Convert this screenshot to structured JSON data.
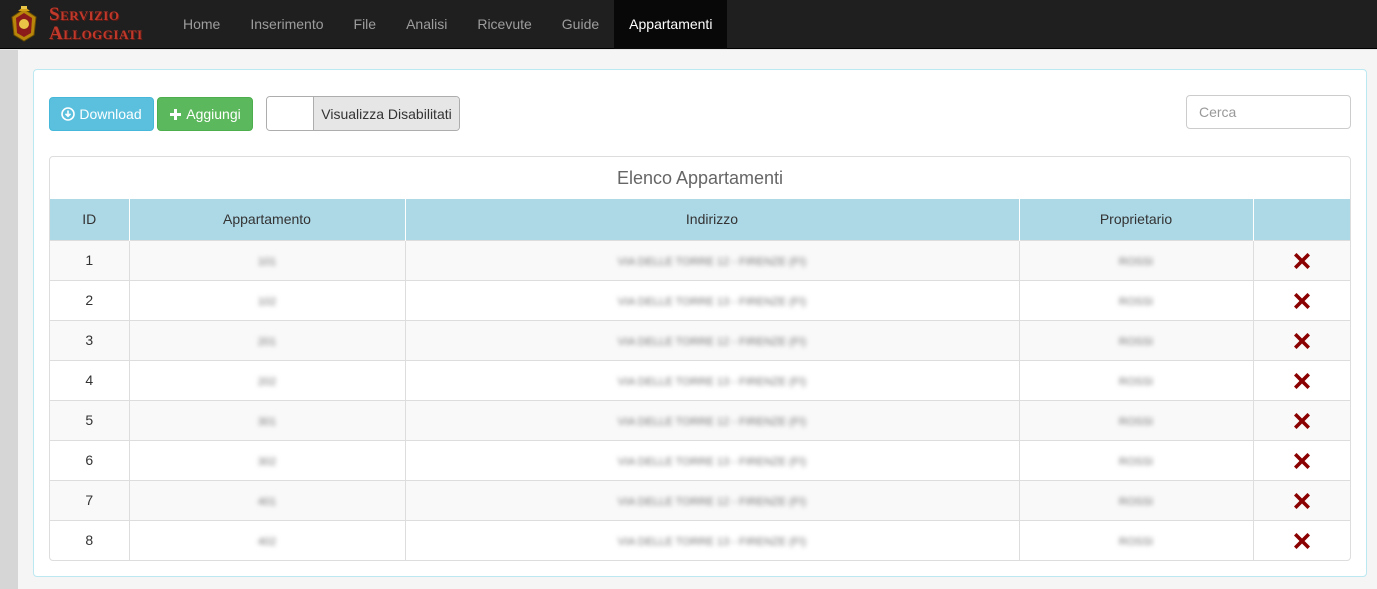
{
  "brand": {
    "line1": "Servizio",
    "line2": "Alloggiati"
  },
  "nav": {
    "items": [
      {
        "label": "Home",
        "name": "nav-home"
      },
      {
        "label": "Inserimento",
        "name": "nav-inserimento"
      },
      {
        "label": "File",
        "name": "nav-file"
      },
      {
        "label": "Analisi",
        "name": "nav-analisi"
      },
      {
        "label": "Ricevute",
        "name": "nav-ricevute"
      },
      {
        "label": "Guide",
        "name": "nav-guide"
      },
      {
        "label": "Appartamenti",
        "name": "nav-appartamenti",
        "active": true
      }
    ]
  },
  "toolbar": {
    "download_label": "Download",
    "download_icon": "download-circle-icon",
    "add_label": "Aggiungi",
    "add_icon": "plus-icon",
    "toggle_label": "Visualizza Disabilitati",
    "search_placeholder": "Cerca"
  },
  "table": {
    "caption": "Elenco Appartamenti",
    "columns": [
      "ID",
      "Appartamento",
      "Indirizzo",
      "Proprietario",
      ""
    ],
    "rows": [
      {
        "id": "1",
        "apt": "101",
        "addr": "VIA DELLE TORRE 12 - FIRENZE (FI)",
        "owner": "ROSSI"
      },
      {
        "id": "2",
        "apt": "102",
        "addr": "VIA DELLE TORRE 13 - FIRENZE (FI)",
        "owner": "ROSSI"
      },
      {
        "id": "3",
        "apt": "201",
        "addr": "VIA DELLE TORRE 12 - FIRENZE (FI)",
        "owner": "ROSSI"
      },
      {
        "id": "4",
        "apt": "202",
        "addr": "VIA DELLE TORRE 13 - FIRENZE (FI)",
        "owner": "ROSSI"
      },
      {
        "id": "5",
        "apt": "301",
        "addr": "VIA DELLE TORRE 12 - FIRENZE (FI)",
        "owner": "ROSSI"
      },
      {
        "id": "6",
        "apt": "302",
        "addr": "VIA DELLE TORRE 13 - FIRENZE (FI)",
        "owner": "ROSSI"
      },
      {
        "id": "7",
        "apt": "401",
        "addr": "VIA DELLE TORRE 12 - FIRENZE (FI)",
        "owner": "ROSSI"
      },
      {
        "id": "8",
        "apt": "402",
        "addr": "VIA DELLE TORRE 13 - FIRENZE (FI)",
        "owner": "ROSSI"
      }
    ],
    "delete_icon": "delete-x-icon",
    "delete_color": "#8b0000"
  },
  "colors": {
    "navbar": "#1f1f1f",
    "brand": "#c0392b",
    "header_row": "#add8e6",
    "download_button": "#5bc0de",
    "add_button": "#5cb85c"
  }
}
